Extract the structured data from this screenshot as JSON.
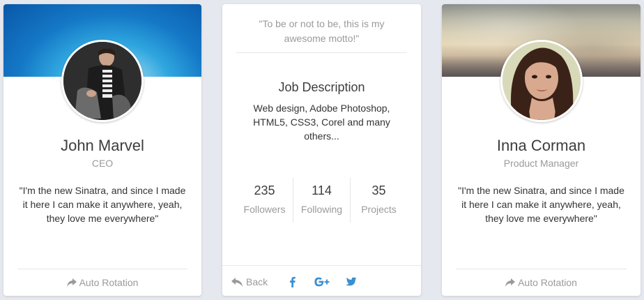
{
  "cards": [
    {
      "name": "John Marvel",
      "role": "CEO",
      "quote": "\"I'm the new Sinatra, and since I made it here I can make it anywhere, yeah, they love me everywhere\"",
      "rotate_label": "Auto Rotation",
      "cover_color": "#1478c6"
    },
    {
      "name": "Inna Corman",
      "role": "Product Manager",
      "quote": "\"I'm the new Sinatra, and since I made it here I can make it anywhere, yeah, they love me everywhere\"",
      "rotate_label": "Auto Rotation"
    }
  ],
  "back_card": {
    "motto": "\"To be or not to be, this is my awesome motto!\"",
    "job_title": "Job Description",
    "job_description": "Web design, Adobe Photoshop, HTML5, CSS3, Corel and many others...",
    "stats": [
      {
        "value": "235",
        "label": "Followers"
      },
      {
        "value": "114",
        "label": "Following"
      },
      {
        "value": "35",
        "label": "Projects"
      }
    ],
    "back_label": "Back",
    "social_icons": [
      "facebook-icon",
      "google-plus-icon",
      "twitter-icon"
    ]
  },
  "colors": {
    "background": "#e5e8ee",
    "social_blue": "#3a8fd0",
    "muted_text": "#9a9a9a"
  }
}
